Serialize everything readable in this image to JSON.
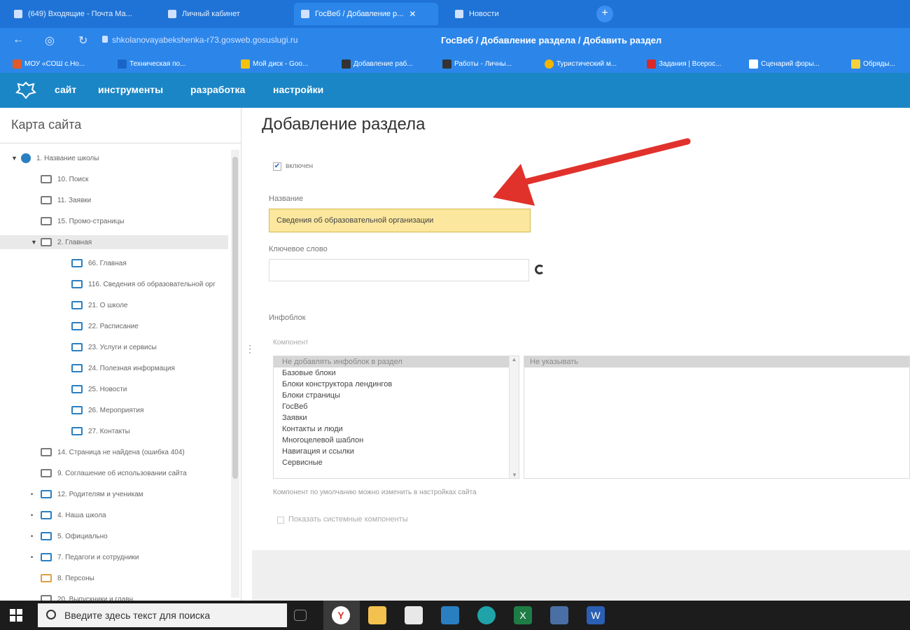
{
  "browser": {
    "tabs": [
      {
        "label": "(649) Входящие - Почта Ма...",
        "active": false
      },
      {
        "label": "Личный кабинет",
        "active": false
      },
      {
        "label": "ГосВеб / Добавление р...",
        "active": true
      },
      {
        "label": "Новости",
        "active": false
      }
    ],
    "new_tab_symbol": "+",
    "url": "shkolanovayabekshenka-r73.gosweb.gosuslugi.ru",
    "page_title": "ГосВеб / Добавление раздела / Добавить раздел",
    "bookmarks": [
      {
        "label": "МОУ «СОШ с.Но...",
        "color": "#e05a2a"
      },
      {
        "label": "Техническая по...",
        "color": "#1a64c8"
      },
      {
        "label": "Мой диск - Goo...",
        "color": "#f4c20d"
      },
      {
        "label": "Добавление раб...",
        "color": "#333333"
      },
      {
        "label": "Работы - Личны...",
        "color": "#333333"
      },
      {
        "label": "Туристический м...",
        "color": "#f2b600"
      },
      {
        "label": "Задания | Всерос...",
        "color": "#d82a2a"
      },
      {
        "label": "Сценарий форы...",
        "color": "#ffffff"
      },
      {
        "label": "Обряды...",
        "color": "#f4d03f"
      }
    ]
  },
  "app_menu": {
    "items": [
      "сайт",
      "инструменты",
      "разработка",
      "настройки"
    ]
  },
  "sidebar": {
    "title": "Карта сайта",
    "tree": [
      {
        "label": "1. Название школы",
        "level": 0,
        "expander": "▼",
        "icon": "globe"
      },
      {
        "label": "10. Поиск",
        "level": 1,
        "icon": "gray"
      },
      {
        "label": "11. Заявки",
        "level": 1,
        "icon": "gray"
      },
      {
        "label": "15. Промо-страницы",
        "level": 1,
        "icon": "gray"
      },
      {
        "label": "2. Главная",
        "level": 1,
        "expander": "▼",
        "icon": "gray",
        "selected": true
      },
      {
        "label": "66. Главная",
        "level": 2,
        "icon": "blue"
      },
      {
        "label": "116. Сведения об образовательной орг",
        "level": 2,
        "icon": "blue"
      },
      {
        "label": "21. О школе",
        "level": 2,
        "icon": "blue"
      },
      {
        "label": "22. Расписание",
        "level": 2,
        "icon": "blue"
      },
      {
        "label": "23. Услуги и сервисы",
        "level": 2,
        "icon": "blue"
      },
      {
        "label": "24. Полезная информация",
        "level": 2,
        "icon": "blue"
      },
      {
        "label": "25. Новости",
        "level": 2,
        "icon": "blue"
      },
      {
        "label": "26. Мероприятия",
        "level": 2,
        "icon": "blue"
      },
      {
        "label": "27. Контакты",
        "level": 2,
        "icon": "blue"
      },
      {
        "label": "14. Страница не найдена (ошибка 404)",
        "level": 1,
        "icon": "gray"
      },
      {
        "label": "9. Соглашение об использовании сайта",
        "level": 1,
        "icon": "gray"
      },
      {
        "label": "12. Родителям и ученикам",
        "level": 1,
        "expander": "•",
        "icon": "blue"
      },
      {
        "label": "4. Наша школа",
        "level": 1,
        "expander": "•",
        "icon": "blue"
      },
      {
        "label": "5. Официально",
        "level": 1,
        "expander": "•",
        "icon": "blue"
      },
      {
        "label": "7. Педагоги и сотрудники",
        "level": 1,
        "expander": "•",
        "icon": "blue"
      },
      {
        "label": "8. Персоны",
        "level": 1,
        "icon": "orange"
      },
      {
        "label": "20. Выпускники и главн",
        "level": 1,
        "icon": "gray"
      }
    ]
  },
  "form": {
    "heading": "Добавление раздела",
    "enabled_label": "включен",
    "enabled_check": "✔",
    "name_label": "Название",
    "name_value": "Сведения об образовательной организации",
    "keyword_label": "Ключевое слово",
    "infoblock_label": "Инфоблок",
    "component_label": "Компонент",
    "component_options": [
      "Не добавлять инфоблок в раздел",
      "Базовые блоки",
      "Блоки конструктора лендингов",
      "Блоки страницы",
      "ГосВеб",
      "Заявки",
      "Контакты и люди",
      "Многоцелевой шаблон",
      "Навигация и ссылки",
      "Сервисные"
    ],
    "component_selected_index": 0,
    "template_selected": "Не указывать",
    "hint": "Компонент по умолчанию можно изменить в настройках сайта",
    "system_components_label": "Показать системные компоненты"
  },
  "taskbar": {
    "search_placeholder": "Введите здесь текст для поиска",
    "apps": [
      "task-view",
      "yandex-browser",
      "file-explorer",
      "store",
      "mail",
      "edge",
      "excel",
      "remote-desktop",
      "word"
    ]
  },
  "colors": {
    "annotation_arrow": "#e0322b",
    "app_header": "#1b86c6",
    "name_highlight": "#fbe79e"
  }
}
